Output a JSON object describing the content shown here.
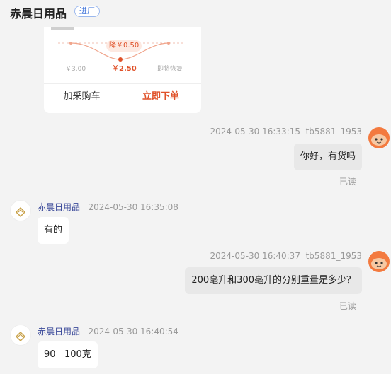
{
  "header": {
    "shop_name": "赤晨日用品",
    "badge": "进厂"
  },
  "product_card": {
    "drop_tag": "降￥0.50",
    "price_before": "￥3.00",
    "price_now": "￥2.50",
    "price_after": "即将恢复",
    "add_cart_label": "加采购车",
    "buy_now_label": "立即下单"
  },
  "messages": [
    {
      "direction": "out",
      "time": "2024-05-30 16:33:15",
      "sender": "tb5881_1953",
      "text": "你好，有货吗",
      "status": "已读"
    },
    {
      "direction": "in",
      "time": "2024-05-30 16:35:08",
      "sender": "赤晨日用品",
      "text": "有的"
    },
    {
      "direction": "out",
      "time": "2024-05-30 16:40:37",
      "sender": "tb5881_1953",
      "text": "200毫升和300毫升的分别重量是多少？",
      "status": "已读"
    },
    {
      "direction": "in",
      "time": "2024-05-30 16:40:54",
      "sender": "赤晨日用品",
      "text": "90   100克"
    }
  ],
  "colors": {
    "accent": "#e0522a",
    "nick": "#3b4a9a",
    "avatar_user": "#f37a3f",
    "logo": "#c9a24a"
  },
  "icons": {
    "user_avatar": "cartoon-cat-icon",
    "shop_avatar": "shop-logo-icon"
  }
}
